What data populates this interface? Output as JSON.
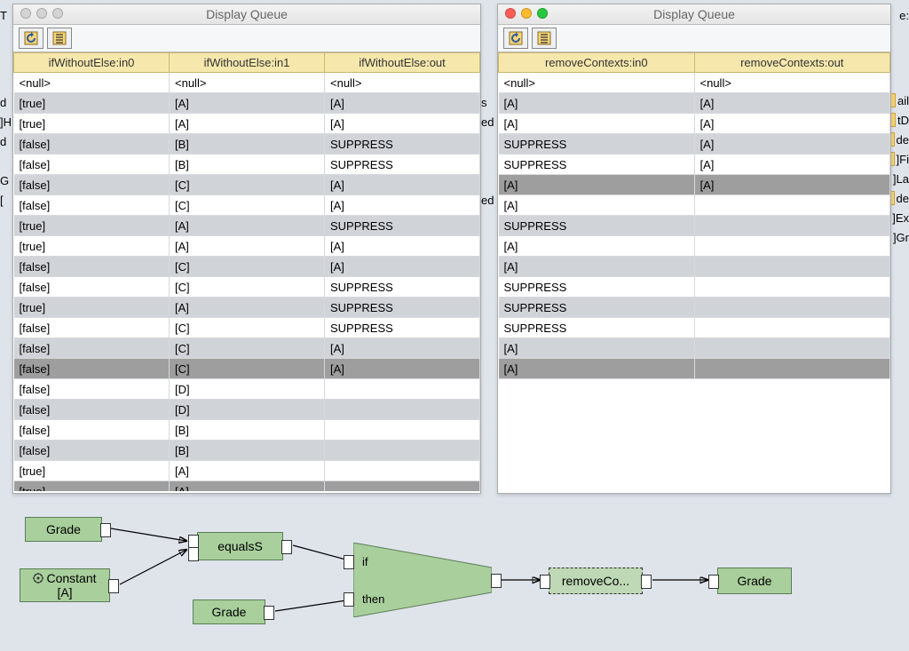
{
  "bg_left_label": "T",
  "bg_left_rows": [
    "d",
    "]H",
    "d",
    "",
    "G",
    "[",
    ""
  ],
  "bg_mid_rows": [
    "s",
    "ed",
    "",
    "",
    "",
    "ed",
    "",
    ""
  ],
  "bg_right_label": "e:",
  "bg_right_rows": [
    "ail",
    "tD",
    "de",
    "]Fi",
    "]La",
    "de",
    "]Ex",
    "]Gr"
  ],
  "windows": {
    "left": {
      "title": "Display Queue",
      "closeActive": false,
      "headers": [
        "ifWithoutElse:in0",
        "ifWithoutElse:in1",
        "ifWithoutElse:out"
      ],
      "rows": [
        {
          "c": [
            "<null>",
            "<null>",
            "<null>"
          ],
          "alt": false
        },
        {
          "c": [
            "[true]",
            "[A]",
            "[A]"
          ],
          "alt": true
        },
        {
          "c": [
            "[true]",
            "[A]",
            "[A]"
          ],
          "alt": false
        },
        {
          "c": [
            "[false]",
            "[B]",
            "SUPPRESS"
          ],
          "alt": true
        },
        {
          "c": [
            "[false]",
            "[B]",
            "SUPPRESS"
          ],
          "alt": false
        },
        {
          "c": [
            "[false]",
            "[C]",
            "[A]"
          ],
          "alt": true
        },
        {
          "c": [
            "[false]",
            "[C]",
            "[A]"
          ],
          "alt": false
        },
        {
          "c": [
            "[true]",
            "[A]",
            "SUPPRESS"
          ],
          "alt": true
        },
        {
          "c": [
            "[true]",
            "[A]",
            "[A]"
          ],
          "alt": false
        },
        {
          "c": [
            "[false]",
            "[C]",
            "[A]"
          ],
          "alt": true
        },
        {
          "c": [
            "[false]",
            "[C]",
            "SUPPRESS"
          ],
          "alt": false
        },
        {
          "c": [
            "[true]",
            "[A]",
            "SUPPRESS"
          ],
          "alt": true
        },
        {
          "c": [
            "[false]",
            "[C]",
            "SUPPRESS"
          ],
          "alt": false
        },
        {
          "c": [
            "[false]",
            "[C]",
            "[A]"
          ],
          "alt": true
        },
        {
          "c": [
            "[false]",
            "[C]",
            "[A]"
          ],
          "sel": true
        },
        {
          "c": [
            "[false]",
            "[D]",
            ""
          ],
          "alt": false
        },
        {
          "c": [
            "[false]",
            "[D]",
            ""
          ],
          "alt": true
        },
        {
          "c": [
            "[false]",
            "[B]",
            ""
          ],
          "alt": false
        },
        {
          "c": [
            "[false]",
            "[B]",
            ""
          ],
          "alt": true
        },
        {
          "c": [
            "[true]",
            "[A]",
            ""
          ],
          "alt": false
        },
        {
          "c": [
            "[true]",
            "[A]",
            ""
          ],
          "sel": true
        }
      ]
    },
    "right": {
      "title": "Display Queue",
      "closeActive": true,
      "headers": [
        "removeContexts:in0",
        "removeContexts:out"
      ],
      "rows": [
        {
          "c": [
            "<null>",
            "<null>"
          ],
          "alt": false
        },
        {
          "c": [
            "[A]",
            "[A]"
          ],
          "alt": true
        },
        {
          "c": [
            "[A]",
            "[A]"
          ],
          "alt": false
        },
        {
          "c": [
            "SUPPRESS",
            "[A]"
          ],
          "alt": true
        },
        {
          "c": [
            "SUPPRESS",
            "[A]"
          ],
          "alt": false
        },
        {
          "c": [
            "[A]",
            "[A]"
          ],
          "sel": true
        },
        {
          "c": [
            "[A]",
            ""
          ],
          "alt": false
        },
        {
          "c": [
            "SUPPRESS",
            ""
          ],
          "alt": true
        },
        {
          "c": [
            "[A]",
            ""
          ],
          "alt": false
        },
        {
          "c": [
            "[A]",
            ""
          ],
          "alt": true
        },
        {
          "c": [
            "SUPPRESS",
            ""
          ],
          "alt": false
        },
        {
          "c": [
            "SUPPRESS",
            ""
          ],
          "alt": true
        },
        {
          "c": [
            "SUPPRESS",
            ""
          ],
          "alt": false
        },
        {
          "c": [
            "[A]",
            ""
          ],
          "alt": true
        },
        {
          "c": [
            "[A]",
            ""
          ],
          "sel": true
        }
      ]
    }
  },
  "flow": {
    "grade1": "Grade",
    "constant": "Constant",
    "constantVal": "[A]",
    "equalsS": "equalsS",
    "grade2": "Grade",
    "if": "if",
    "then": "then",
    "removeCo": "removeCo...",
    "grade3": "Grade"
  }
}
